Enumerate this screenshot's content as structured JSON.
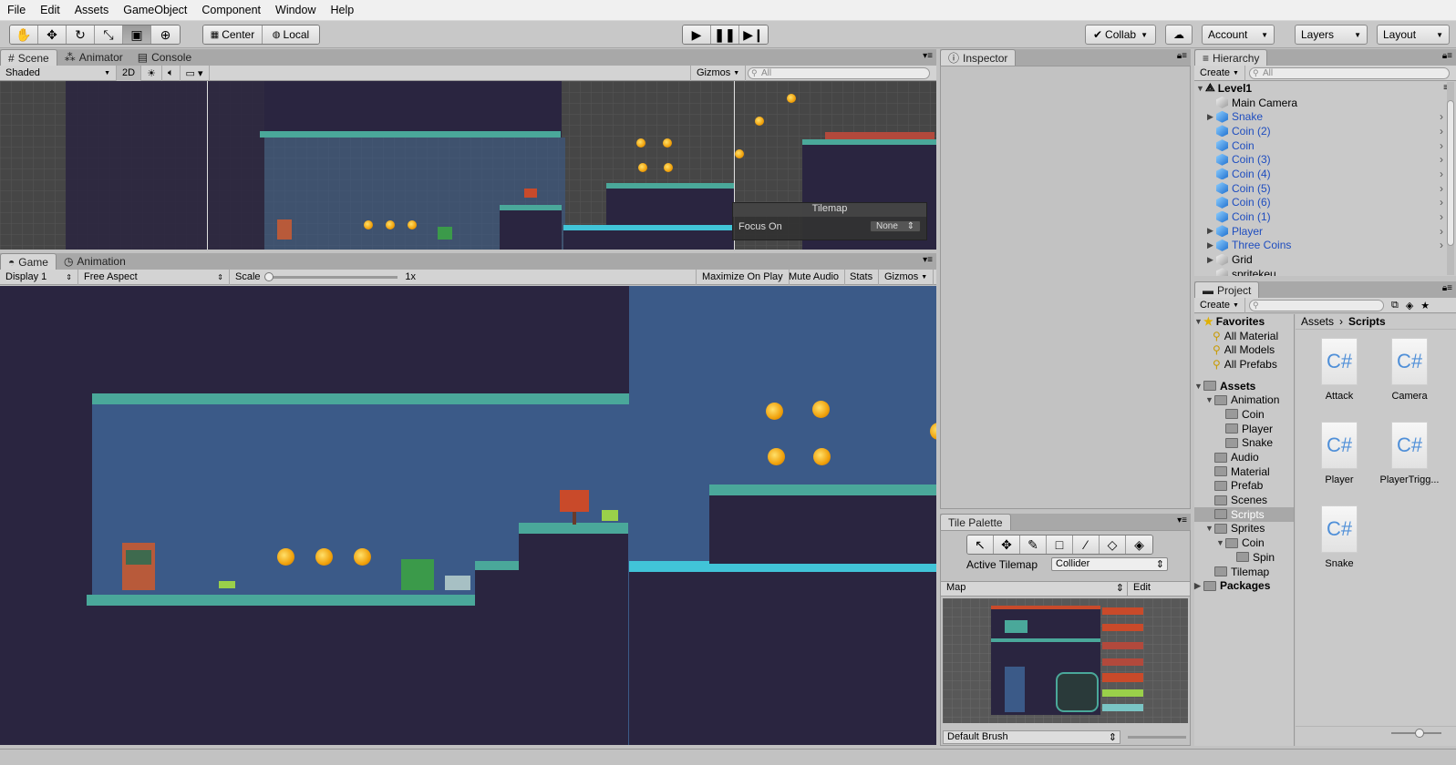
{
  "menu": [
    "File",
    "Edit",
    "Assets",
    "GameObject",
    "Component",
    "Window",
    "Help"
  ],
  "toolbar": {
    "pivot": "Center",
    "space": "Local",
    "collab": "Collab",
    "account": "Account",
    "layers": "Layers",
    "layout": "Layout"
  },
  "scene": {
    "tabs": [
      "Scene",
      "Animator",
      "Console"
    ],
    "shading": "Shaded",
    "mode2d": "2D",
    "gizmos": "Gizmos",
    "search_placeholder": "All",
    "overlay_title": "Tilemap",
    "overlay_label": "Focus On",
    "overlay_value": "None"
  },
  "game": {
    "tabs": [
      "Game",
      "Animation"
    ],
    "display": "Display 1",
    "aspect": "Free Aspect",
    "scale_label": "Scale",
    "scale_value": "1x",
    "maximize": "Maximize On Play",
    "mute": "Mute Audio",
    "stats": "Stats",
    "gizmos": "Gizmos"
  },
  "inspector": {
    "tab": "Inspector"
  },
  "tile_palette": {
    "tab": "Tile Palette",
    "active_label": "Active Tilemap",
    "active_value": "Collider",
    "palette": "Map",
    "edit": "Edit",
    "brush": "Default Brush"
  },
  "hierarchy": {
    "tab": "Hierarchy",
    "create": "Create",
    "search_placeholder": "All",
    "scene": "Level1",
    "items": [
      {
        "label": "Main Camera",
        "expandable": false,
        "prefab": false
      },
      {
        "label": "Snake",
        "expandable": true,
        "prefab": true
      },
      {
        "label": "Coin (2)",
        "expandable": false,
        "prefab": true
      },
      {
        "label": "Coin",
        "expandable": false,
        "prefab": true
      },
      {
        "label": "Coin (3)",
        "expandable": false,
        "prefab": true
      },
      {
        "label": "Coin (4)",
        "expandable": false,
        "prefab": true
      },
      {
        "label": "Coin (5)",
        "expandable": false,
        "prefab": true
      },
      {
        "label": "Coin (6)",
        "expandable": false,
        "prefab": true
      },
      {
        "label": "Coin (1)",
        "expandable": false,
        "prefab": true
      },
      {
        "label": "Player",
        "expandable": true,
        "prefab": true
      },
      {
        "label": "Three Coins",
        "expandable": true,
        "prefab": true
      },
      {
        "label": "Grid",
        "expandable": true,
        "prefab": false
      },
      {
        "label": "spritekeu",
        "expandable": false,
        "prefab": false
      }
    ]
  },
  "project": {
    "tab": "Project",
    "create": "Create",
    "favorites_label": "Favorites",
    "favorites": [
      "All Material",
      "All Models",
      "All Prefabs"
    ],
    "assets_label": "Assets",
    "tree": [
      {
        "label": "Animation",
        "depth": 1,
        "expanded": true
      },
      {
        "label": "Coin",
        "depth": 2,
        "expanded": false
      },
      {
        "label": "Player",
        "depth": 2,
        "expanded": false
      },
      {
        "label": "Snake",
        "depth": 2,
        "expanded": false
      },
      {
        "label": "Audio",
        "depth": 1,
        "expanded": false
      },
      {
        "label": "Material",
        "depth": 1,
        "expanded": false
      },
      {
        "label": "Prefab",
        "depth": 1,
        "expanded": false
      },
      {
        "label": "Scenes",
        "depth": 1,
        "expanded": false
      },
      {
        "label": "Scripts",
        "depth": 1,
        "expanded": false
      },
      {
        "label": "Sprites",
        "depth": 1,
        "expanded": true
      },
      {
        "label": "Coin",
        "depth": 2,
        "expanded": true
      },
      {
        "label": "Spin",
        "depth": 3,
        "expanded": false
      },
      {
        "label": "Tilemap",
        "depth": 1,
        "expanded": false
      }
    ],
    "packages_label": "Packages",
    "selected": "Scripts",
    "breadcrumb": [
      "Assets",
      "Scripts"
    ],
    "files": [
      "Attack",
      "Camera",
      "Player",
      "PlayerTrigg...",
      "Snake"
    ],
    "file_glyph": "C#"
  }
}
